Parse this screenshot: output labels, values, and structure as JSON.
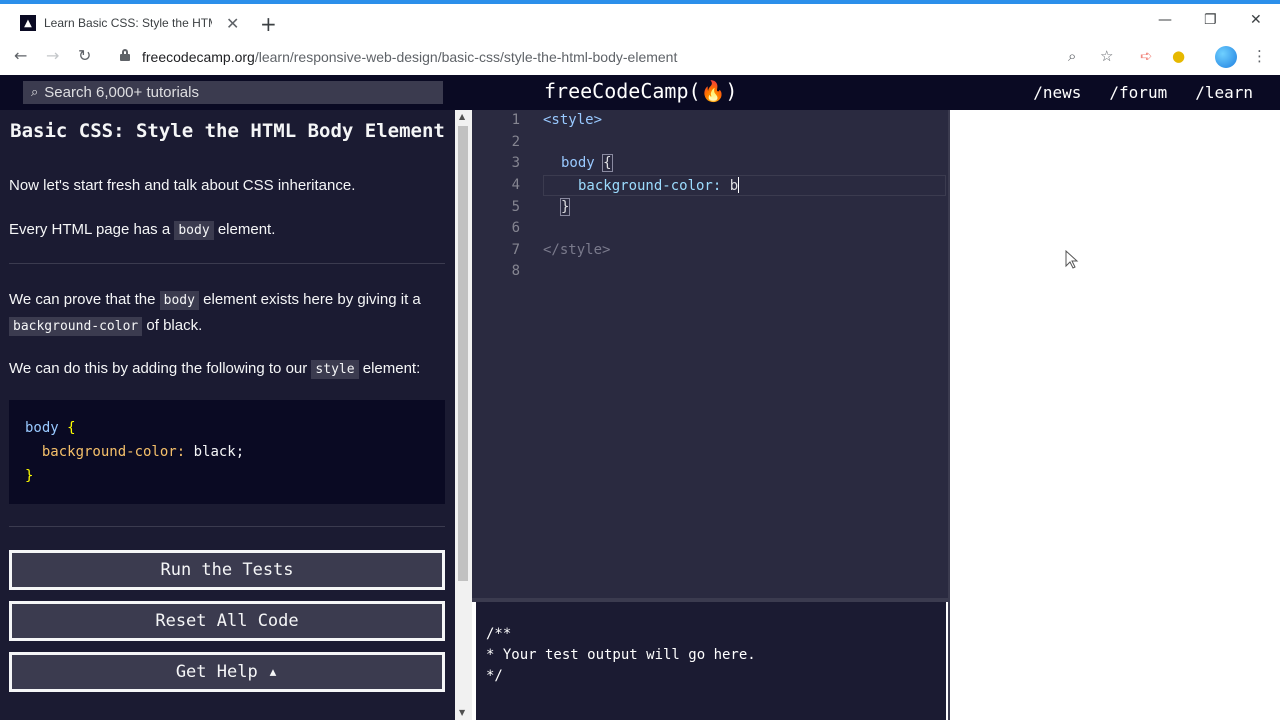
{
  "browser": {
    "tab_title": "Learn Basic CSS: Style the HTML Body Element | freeCodeCamp.org",
    "url_domain": "freecodecamp.org",
    "url_path": "/learn/responsive-web-design/basic-css/style-the-html-body-element"
  },
  "navbar": {
    "search_placeholder": "Search 6,000+ tutorials",
    "brand": "freeCodeCamp(🔥)",
    "links": [
      "/news",
      "/forum",
      "/learn"
    ]
  },
  "challenge": {
    "title": "Basic CSS: Style the HTML Body Element",
    "p1": "Now let's start fresh and talk about CSS inheritance.",
    "p2_before": "Every HTML page has a",
    "p2_code": "body",
    "p2_after": "element.",
    "p3_before": "We can prove that the",
    "p3_code1": "body",
    "p3_mid": "element exists here by giving it a",
    "p3_code2": "background-color",
    "p3_after": "of black.",
    "p4_before": "We can do this by adding the following to our",
    "p4_code": "style",
    "p4_after": "element:",
    "example": {
      "line1_sel": "body",
      "line1_brace": "{",
      "line2_prop": "background-color:",
      "line2_val": "black;",
      "line3_brace": "}"
    },
    "buttons": {
      "run": "Run the Tests",
      "reset": "Reset All Code",
      "help": "Get Help ▴"
    }
  },
  "editor": {
    "line_numbers": [
      "1",
      "2",
      "3",
      "4",
      "5",
      "6",
      "7",
      "8"
    ],
    "l1": "<style>",
    "l3_sel": "body",
    "l3_brace": "{",
    "l4_prop": "background-color:",
    "l4_val": "b",
    "l5_brace": "}",
    "l7": "</style>"
  },
  "output": {
    "text": "/**\n* Your test output will go here.\n*/"
  }
}
